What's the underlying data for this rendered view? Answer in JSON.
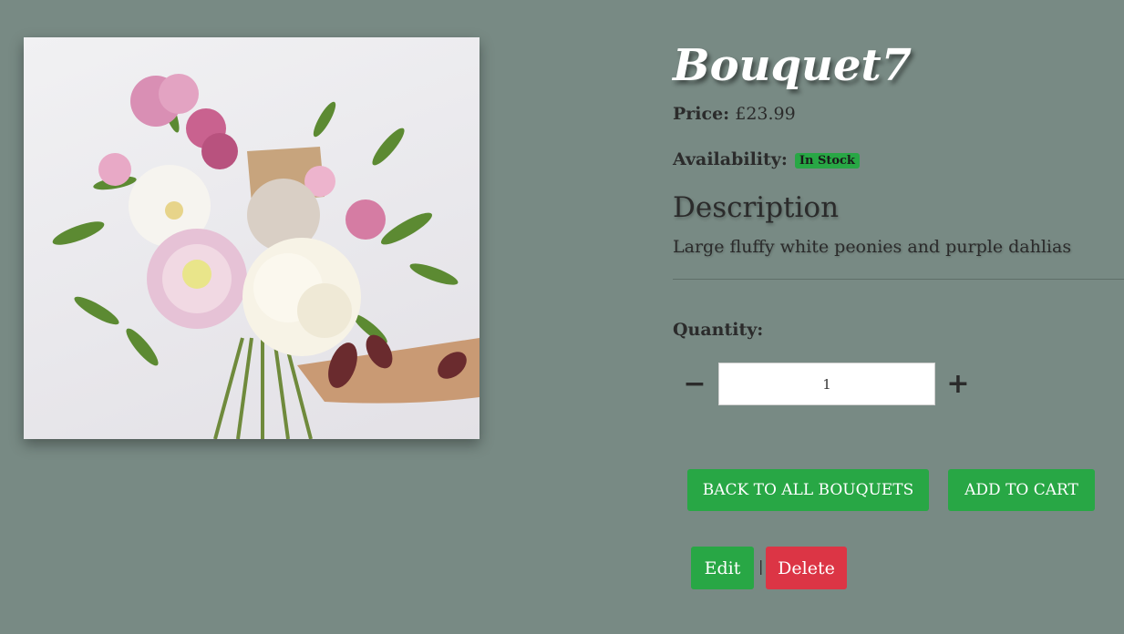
{
  "product": {
    "title": "Bouquet7",
    "price_label": "Price:",
    "price_value": "£23.99",
    "availability_label": "Availability:",
    "availability_badge": "In Stock",
    "description_heading": "Description",
    "description_text": "Large fluffy white peonies and purple dahlias",
    "image_subject": "flower-bouquet-photo"
  },
  "quantity": {
    "label": "Quantity:",
    "value": "1",
    "minus_icon": "minus-icon",
    "plus_icon": "plus-icon"
  },
  "actions": {
    "back_label": "BACK TO ALL BOUQUETS",
    "cart_label": "ADD TO CART",
    "edit_label": "Edit",
    "separator": "|",
    "delete_label": "Delete"
  },
  "colors": {
    "background": "#788a84",
    "success": "#28a745",
    "danger": "#dc3545"
  }
}
